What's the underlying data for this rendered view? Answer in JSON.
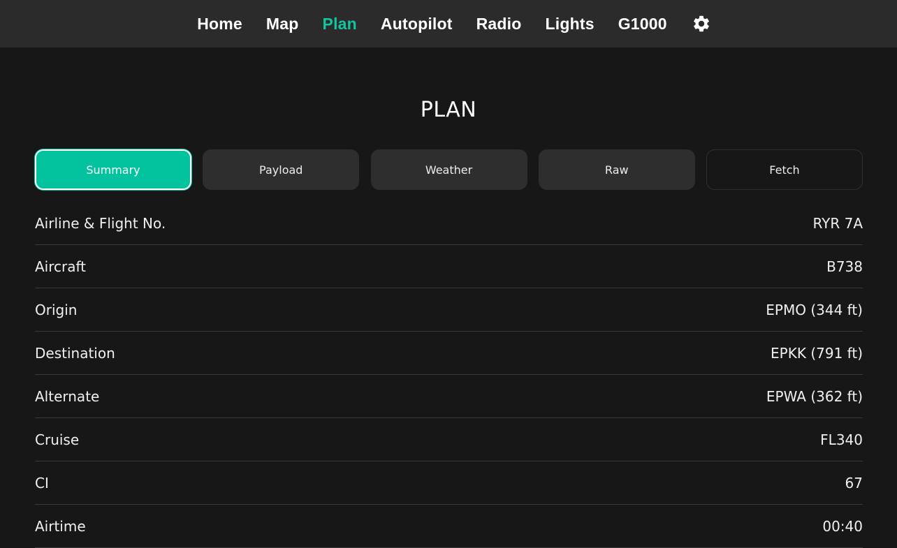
{
  "nav": {
    "items": [
      {
        "label": "Home"
      },
      {
        "label": "Map"
      },
      {
        "label": "Plan"
      },
      {
        "label": "Autopilot"
      },
      {
        "label": "Radio"
      },
      {
        "label": "Lights"
      },
      {
        "label": "G1000"
      }
    ],
    "active": "Plan",
    "settings_icon": "gear-icon"
  },
  "page": {
    "title": "PLAN"
  },
  "tabs": [
    {
      "label": "Summary"
    },
    {
      "label": "Payload"
    },
    {
      "label": "Weather"
    },
    {
      "label": "Raw"
    },
    {
      "label": "Fetch"
    }
  ],
  "summary": {
    "rows": [
      {
        "label": "Airline & Flight No.",
        "value": "RYR 7A"
      },
      {
        "label": "Aircraft",
        "value": "B738"
      },
      {
        "label": "Origin",
        "value": "EPMO (344 ft)"
      },
      {
        "label": "Destination",
        "value": "EPKK (791 ft)"
      },
      {
        "label": "Alternate",
        "value": "EPWA (362 ft)"
      },
      {
        "label": "Cruise",
        "value": "FL340"
      },
      {
        "label": "CI",
        "value": "67"
      },
      {
        "label": "Airtime",
        "value": "00:40"
      }
    ]
  },
  "colors": {
    "accent": "#02c39e",
    "nav_active": "#13c4a1",
    "background": "#171717",
    "nav_background": "#2b2b2b",
    "tab_background": "#2e2e2e"
  }
}
